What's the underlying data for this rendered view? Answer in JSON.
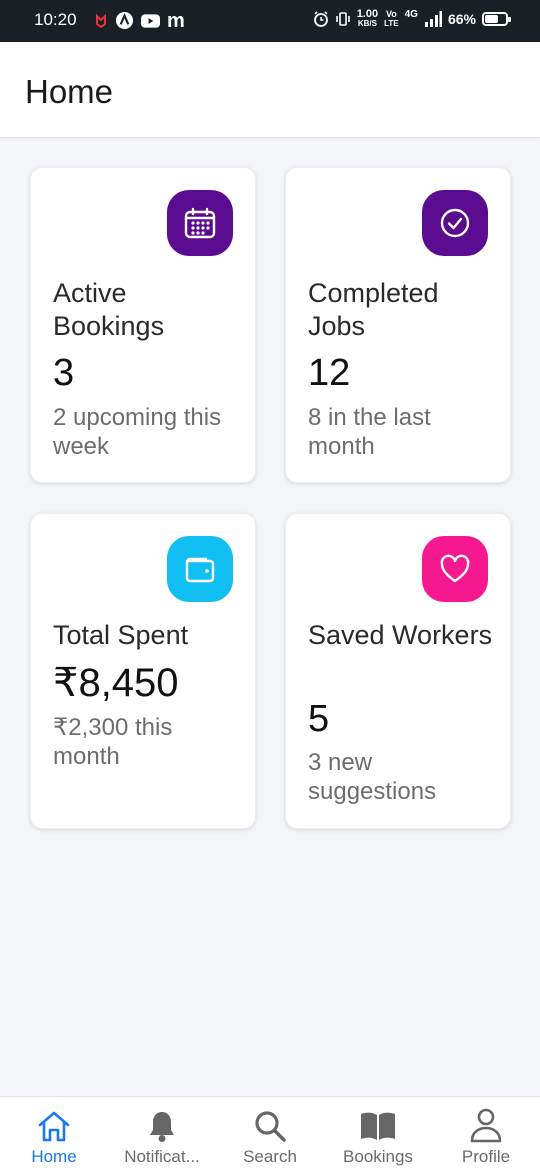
{
  "status_bar": {
    "time": "10:20",
    "left_icons": [
      "notification-app-icon",
      "brave-icon",
      "youtube-icon",
      "m-app-icon"
    ],
    "net_speed_value": "1.00",
    "net_speed_unit": "KB/S",
    "volte_top": "Vo",
    "volte_bottom": "LTE",
    "network": "4G",
    "battery": "66%",
    "battery_level": 0.66
  },
  "header": {
    "title": "Home"
  },
  "cards": [
    {
      "title": "Active Bookings",
      "value": "3",
      "subtitle": "2 upcoming this week",
      "icon": "calendar-icon",
      "icon_color": "#5b0b8f"
    },
    {
      "title": "Completed Jobs",
      "value": "12",
      "subtitle": "8 in the last month",
      "icon": "check-circle-icon",
      "icon_color": "#5b0b8f"
    },
    {
      "title": "Total Spent",
      "value": "₹8,450",
      "subtitle": "₹2,300 this month",
      "icon": "wallet-icon",
      "icon_color": "#12bff2"
    },
    {
      "title": "Saved Workers",
      "value": "5",
      "subtitle": "3 new suggestions",
      "icon": "heart-icon",
      "icon_color": "#f5188f"
    }
  ],
  "nav": {
    "active_color": "#1877f2",
    "items": [
      {
        "label": "Home",
        "icon": "home-icon",
        "active": true
      },
      {
        "label": "Notificat...",
        "icon": "bell-icon",
        "active": false
      },
      {
        "label": "Search",
        "icon": "search-icon",
        "active": false
      },
      {
        "label": "Bookings",
        "icon": "book-icon",
        "active": false
      },
      {
        "label": "Profile",
        "icon": "person-icon",
        "active": false
      }
    ]
  }
}
